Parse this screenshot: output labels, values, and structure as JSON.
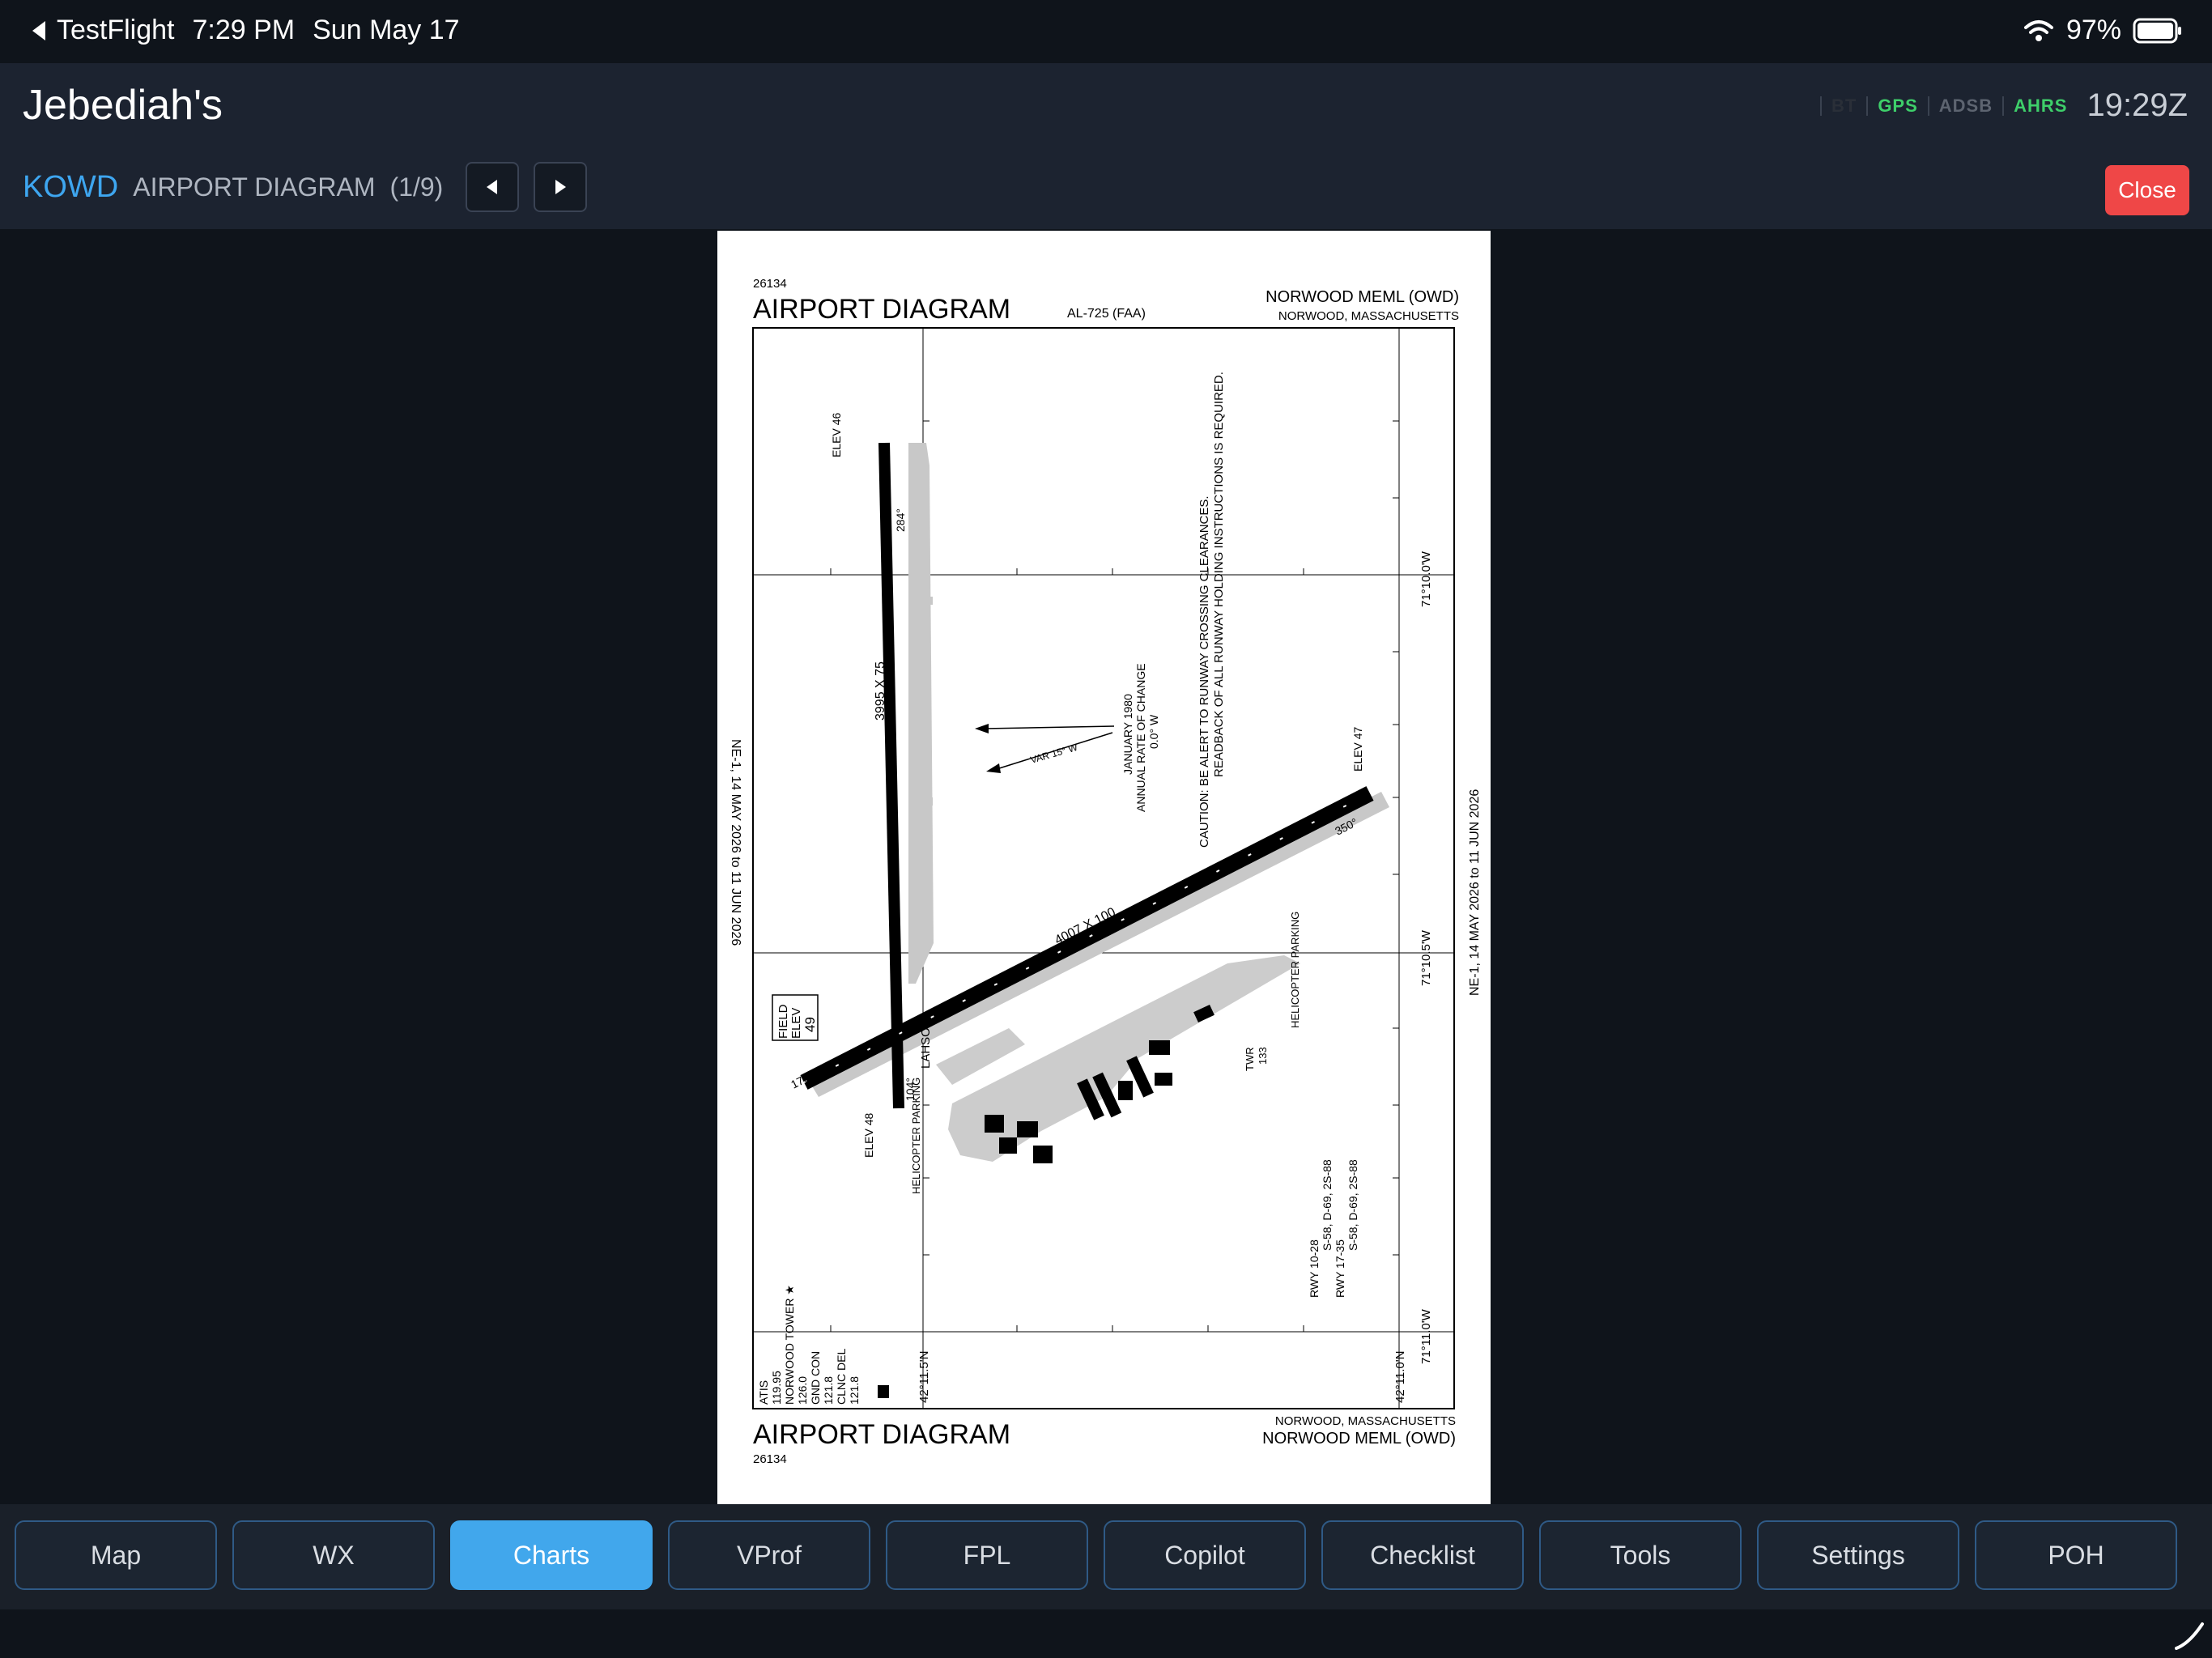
{
  "status_bar": {
    "back_app": "TestFlight",
    "time": "7:29 PM",
    "date": "Sun May 17",
    "battery": "97%"
  },
  "header": {
    "title": "Jebediah's",
    "sensors": [
      {
        "label": "BT",
        "color": "#2a2f38"
      },
      {
        "label": "GPS",
        "color": "#3ecf6a"
      },
      {
        "label": "ADSB",
        "color": "#5d6470"
      },
      {
        "label": "AHRS",
        "color": "#3ecf6a"
      }
    ],
    "zulu_time": "19:29Z"
  },
  "chart_bar": {
    "airport_id": "KOWD",
    "chart_name": "AIRPORT DIAGRAM",
    "chart_count": "(1/9)",
    "close_label": "Close"
  },
  "plate": {
    "chart_number": "26134",
    "title": "AIRPORT DIAGRAM",
    "doc_id": "AL-725 (FAA)",
    "airport_name": "NORWOOD MEML (OWD)",
    "city_state": "NORWOOD, MASSACHUSETTS",
    "caution_line1": "CAUTION: BE ALERT TO RUNWAY CROSSING CLEARANCES.",
    "caution_line2": "READBACK OF ALL RUNWAY HOLDING INSTRUCTIONS IS REQUIRED.",
    "cycle_left": "NE-1, 14 MAY 2026 to 11 JUN 2026",
    "cycle_right": "NE-1, 14 MAY 2026 to 11 JUN 2026",
    "var_line1": "JANUARY 1980",
    "var_line2": "ANNUAL RATE OF CHANGE",
    "var_line3": "0.0° W",
    "var_label": "VAR 15° W",
    "lon_top": "71°10.0'W",
    "lon_mid": "71°10.5'W",
    "lon_bot": "71°11.0'W",
    "lat_left": "42°11.5'N",
    "lat_right": "42°11.0'N",
    "rwy_1028": "3995 X 75",
    "rwy_1735": "4007 X 100",
    "field_elev_1": "FIELD",
    "field_elev_2": "ELEV",
    "field_elev_3": "49",
    "freq_atis": "ATIS",
    "freq_atis_val": "119.95",
    "freq_twr": "NORWOOD TOWER ★",
    "freq_twr_val": "126.0",
    "freq_gnd": "GND CON",
    "freq_gnd_val": "121.8",
    "freq_clnc": "CLNC DEL",
    "freq_clnc_val": "121.8",
    "rwy_data1": "RWY 10-28",
    "rwy_data1b": "S-58, D-69, 2S-88",
    "rwy_data2": "RWY 17-35",
    "rwy_data2b": "S-58, D-69, 2S-88",
    "heli_parking": "HELICOPTER PARKING",
    "twr": "TWR",
    "twr_val": "133",
    "lahso": "LAHSO",
    "elev_46": "ELEV 46",
    "elev_47": "ELEV 47",
    "elev_48": "ELEV 48"
  },
  "tabs": [
    {
      "label": "Map",
      "active": false
    },
    {
      "label": "WX",
      "active": false
    },
    {
      "label": "Charts",
      "active": true
    },
    {
      "label": "VProf",
      "active": false
    },
    {
      "label": "FPL",
      "active": false
    },
    {
      "label": "Copilot",
      "active": false
    },
    {
      "label": "Checklist",
      "active": false
    },
    {
      "label": "Tools",
      "active": false
    },
    {
      "label": "Settings",
      "active": false
    },
    {
      "label": "POH",
      "active": false
    }
  ]
}
